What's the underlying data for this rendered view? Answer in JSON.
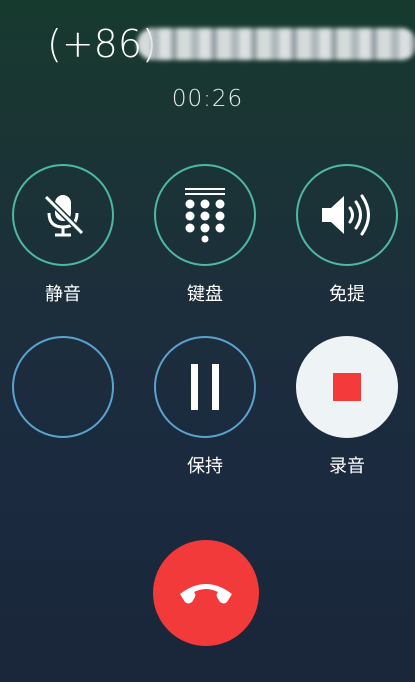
{
  "call": {
    "number_prefix": "(+86)",
    "number_masked": "",
    "duration": "00:26"
  },
  "controls": {
    "mute": {
      "label": "静音",
      "icon": "mic-muted-icon"
    },
    "keypad": {
      "label": "键盘",
      "icon": "keypad-icon"
    },
    "speaker": {
      "label": "免提",
      "icon": "speaker-icon"
    },
    "empty": {
      "label": ""
    },
    "hold": {
      "label": "保持",
      "icon": "pause-icon"
    },
    "record": {
      "label": "录音",
      "icon": "record-icon"
    }
  },
  "end_call": {
    "icon": "hang-up-icon"
  },
  "colors": {
    "teal_ring": "#4fb7a3",
    "blue_ring": "#5aa3cf",
    "record_bg": "#eef3f6",
    "record_square": "#f43a3a",
    "end_call_bg": "#f23a3a"
  }
}
